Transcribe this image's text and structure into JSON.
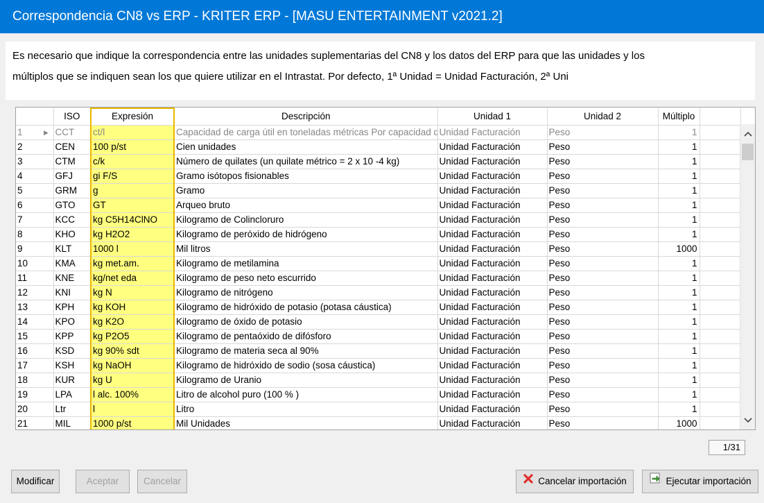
{
  "window": {
    "title": "Correspondencia CN8 vs ERP - KRITER ERP - [MASU ENTERTAINMENT v2021.2]"
  },
  "info": {
    "line1": "Es necesario que indique la correspondencia entre las unidades suplementarias del CN8 y los datos del ERP para que las unidades y los",
    "line2": "múltiplos que se indiquen sean los que quiere utilizar en el Intrastat. Por defecto, 1ª Unidad = Unidad Facturación, 2ª Uni"
  },
  "grid": {
    "columns": [
      "",
      "ISO",
      "Expresión",
      "Descripción",
      "Unidad 1",
      "Unidad 2",
      "Múltiplo"
    ],
    "rows": [
      {
        "n": "1",
        "iso": "CCT",
        "expr": "ct/l",
        "desc": "Capacidad de carga útil en toneladas métricas Por capacidad de",
        "u1": "Unidad Facturación",
        "u2": "Peso",
        "mult": "1"
      },
      {
        "n": "2",
        "iso": "CEN",
        "expr": "100 p/st",
        "desc": "Cien unidades",
        "u1": "Unidad Facturación",
        "u2": "Peso",
        "mult": "1"
      },
      {
        "n": "3",
        "iso": "CTM",
        "expr": "c/k",
        "desc": "Número de quilates (un quilate métrico = 2 x 10 -4 kg)",
        "u1": "Unidad Facturación",
        "u2": "Peso",
        "mult": "1"
      },
      {
        "n": "4",
        "iso": "GFJ",
        "expr": "gi F/S",
        "desc": "Gramo isótopos fisionables",
        "u1": "Unidad Facturación",
        "u2": "Peso",
        "mult": "1"
      },
      {
        "n": "5",
        "iso": "GRM",
        "expr": "g",
        "desc": "Gramo",
        "u1": "Unidad Facturación",
        "u2": "Peso",
        "mult": "1"
      },
      {
        "n": "6",
        "iso": "GTO",
        "expr": "GT",
        "desc": "Arqueo bruto",
        "u1": "Unidad Facturación",
        "u2": "Peso",
        "mult": "1"
      },
      {
        "n": "7",
        "iso": "KCC",
        "expr": "kg C5H14ClNO",
        "desc": "Kilogramo de Colincloruro",
        "u1": "Unidad Facturación",
        "u2": "Peso",
        "mult": "1"
      },
      {
        "n": "8",
        "iso": "KHO",
        "expr": "kg H2O2",
        "desc": "Kilogramo de peróxido de hidrógeno",
        "u1": "Unidad Facturación",
        "u2": "Peso",
        "mult": "1"
      },
      {
        "n": "9",
        "iso": "KLT",
        "expr": "1000 l",
        "desc": "Mil litros",
        "u1": "Unidad Facturación",
        "u2": "Peso",
        "mult": "1000"
      },
      {
        "n": "10",
        "iso": "KMA",
        "expr": "kg met.am.",
        "desc": "Kilogramo de metilamina",
        "u1": "Unidad Facturación",
        "u2": "Peso",
        "mult": "1"
      },
      {
        "n": "11",
        "iso": "KNE",
        "expr": "kg/net eda",
        "desc": "Kilogramo de peso neto escurrido",
        "u1": "Unidad Facturación",
        "u2": "Peso",
        "mult": "1"
      },
      {
        "n": "12",
        "iso": "KNI",
        "expr": "kg N",
        "desc": "Kilogramo de nitrógeno",
        "u1": "Unidad Facturación",
        "u2": "Peso",
        "mult": "1"
      },
      {
        "n": "13",
        "iso": "KPH",
        "expr": "kg KOH",
        "desc": "Kilogramo de hidróxido de potasio (potasa cáustica)",
        "u1": "Unidad Facturación",
        "u2": "Peso",
        "mult": "1"
      },
      {
        "n": "14",
        "iso": "KPO",
        "expr": "kg K2O",
        "desc": "Kilogramo de óxido de potasio",
        "u1": "Unidad Facturación",
        "u2": "Peso",
        "mult": "1"
      },
      {
        "n": "15",
        "iso": "KPP",
        "expr": "kg P2O5",
        "desc": "Kilogramo de pentaóxido de difósforo",
        "u1": "Unidad Facturación",
        "u2": "Peso",
        "mult": "1"
      },
      {
        "n": "16",
        "iso": "KSD",
        "expr": "kg 90% sdt",
        "desc": "Kilogramo de materia seca al 90%",
        "u1": "Unidad Facturación",
        "u2": "Peso",
        "mult": "1"
      },
      {
        "n": "17",
        "iso": "KSH",
        "expr": "kg NaOH",
        "desc": "Kilogramo de hidróxido de sodio (sosa cáustica)",
        "u1": "Unidad Facturación",
        "u2": "Peso",
        "mult": "1"
      },
      {
        "n": "18",
        "iso": "KUR",
        "expr": "kg U",
        "desc": "Kilogramo de Uranio",
        "u1": "Unidad Facturación",
        "u2": "Peso",
        "mult": "1"
      },
      {
        "n": "19",
        "iso": "LPA",
        "expr": "l alc. 100%",
        "desc": "Litro de alcohol puro (100 % )",
        "u1": "Unidad Facturación",
        "u2": "Peso",
        "mult": "1"
      },
      {
        "n": "20",
        "iso": "Ltr",
        "expr": "l",
        "desc": "Litro",
        "u1": "Unidad Facturación",
        "u2": "Peso",
        "mult": "1"
      },
      {
        "n": "21",
        "iso": "MIL",
        "expr": "1000 p/st",
        "desc": "Mil Unidades",
        "u1": "Unidad Facturación",
        "u2": "Peso",
        "mult": "1000"
      }
    ],
    "current_row_marker": "▶"
  },
  "pager": {
    "text": "1/31"
  },
  "buttons": {
    "modificar": "Modificar",
    "aceptar": "Aceptar",
    "cancelar": "Cancelar",
    "cancelar_importacion": "Cancelar importación",
    "ejecutar_importacion": "Ejecutar importación"
  },
  "icons": {
    "scroll_up": "chevron-up-icon",
    "scroll_down": "chevron-down-icon",
    "cancel": "red-x-icon",
    "execute": "import-arrow-icon"
  }
}
